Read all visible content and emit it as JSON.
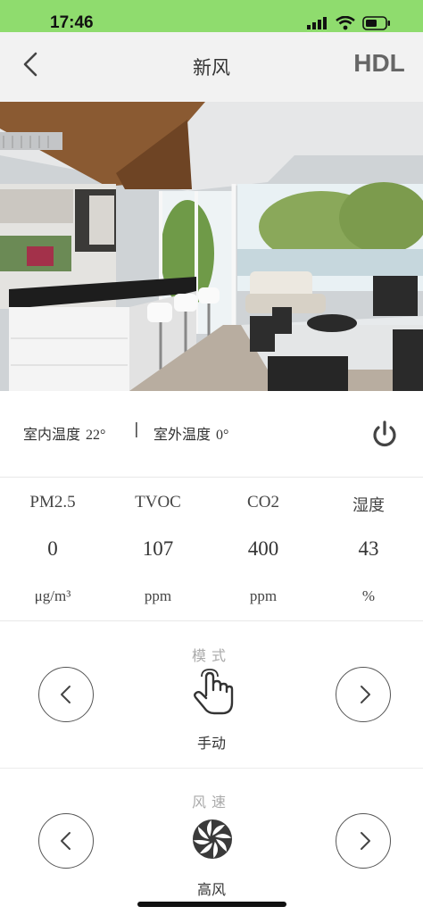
{
  "status_bar": {
    "time": "17:46"
  },
  "nav": {
    "title": "新风",
    "brand": "HDL"
  },
  "temperature": {
    "indoor_label": "室内温度",
    "indoor_value": "22°",
    "separator": "|",
    "outdoor_label": "室外温度",
    "outdoor_value": "0°"
  },
  "air_quality": [
    {
      "label": "PM2.5",
      "value": "0",
      "unit": "μg/m³"
    },
    {
      "label": "TVOC",
      "value": "107",
      "unit": "ppm"
    },
    {
      "label": "CO2",
      "value": "400",
      "unit": "ppm"
    },
    {
      "label": "湿度",
      "value": "43",
      "unit": "%"
    }
  ],
  "mode": {
    "title": "模式",
    "value": "手动",
    "icon": "hand-pointer-icon"
  },
  "fan_speed": {
    "title": "风速",
    "value": "高风",
    "icon": "fan-icon"
  },
  "colors": {
    "status_bar": "#8fdc6e",
    "nav_bar": "#f2f2f2",
    "text": "#333333",
    "muted": "#aaaaaa"
  }
}
